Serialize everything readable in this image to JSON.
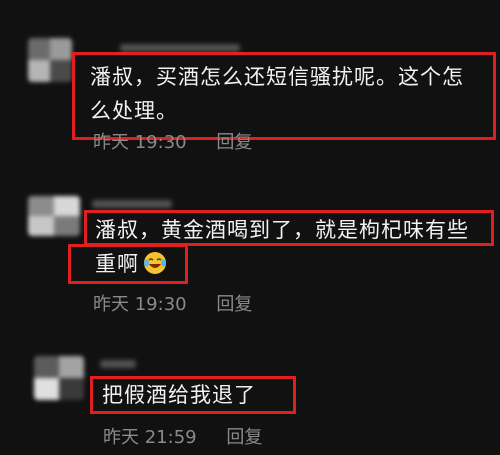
{
  "comments": [
    {
      "text_line1": "潘叔，买酒怎么还短信骚扰呢。这个怎",
      "text_line2": "么处理。",
      "time": "昨天 19:30",
      "reply_label": "回复"
    },
    {
      "text_line1": "潘叔，黄金酒喝到了，就是枸杞味有些",
      "text_line2": "重啊",
      "emoji": "laughing-crying-emoji",
      "time": "昨天 19:30",
      "reply_label": "回复"
    },
    {
      "text_line1": "把假酒给我退了",
      "time": "昨天 21:59",
      "reply_label": "回复"
    }
  ],
  "colors": {
    "background": "#111112",
    "highlight_border": "#e01f1f",
    "text": "#f2f2f2",
    "meta_text": "#8a8a8a"
  }
}
